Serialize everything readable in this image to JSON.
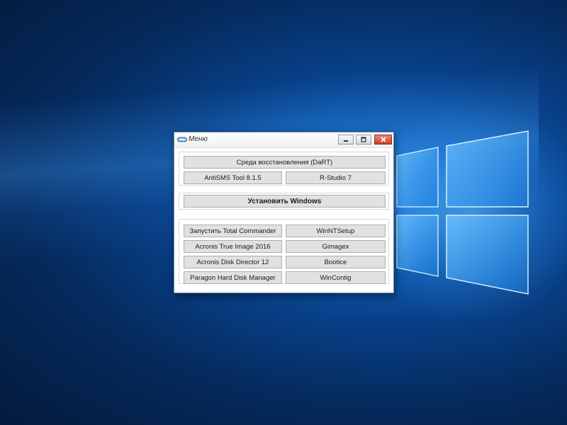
{
  "window": {
    "title": "Меню"
  },
  "top_section": {
    "dart_label": "Среда восстановления (DaRT)",
    "antisms_label": "AntiSMS Tool 8.1.5",
    "rstudio_label": "R-Studio 7"
  },
  "install_section": {
    "install_label": "Установить Windows"
  },
  "tools_section": {
    "left": [
      "Запустить Total Commander",
      "Acronis True Image 2016",
      "Acronis Disk Director 12",
      "Paragon Hard Disk Manager"
    ],
    "right": [
      "WinNTSetup",
      "Gimagex",
      "Bootice",
      "WinContig"
    ]
  },
  "colors": {
    "desktop_blue": "#0e5fb8",
    "close_red": "#c8412a"
  }
}
